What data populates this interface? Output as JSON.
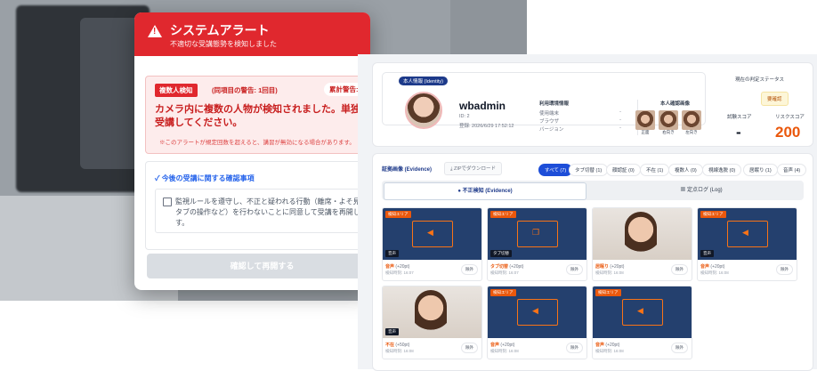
{
  "alert": {
    "title": "システムアラート",
    "subtitle": "不適切な受講態勢を検知しました",
    "detection_badge": "複数人検知",
    "detection_count": "(同項目の警告: 1回目)",
    "cumulative_label": "累計警告:",
    "message": "カメラ内に複数の人物が検知されました。単独で受講してください。",
    "note": "※このアラートが規定回数を超えると、講習が無効になる場合があります。",
    "confirm_title": "今後の受講に関する確認事項",
    "confirm_text": "監視ルールを遵守し、不正と疑われる行動（離席・よそ見・別タブの操作など）を行わないことに同意して受講を再開します。",
    "resume_button": "確認して再開する"
  },
  "admin": {
    "identity_badge": "本人情報 (Identity)",
    "username": "wbadmin",
    "user_id": "ID: 2",
    "registered": "登録: 2026/6/29 17:52:12",
    "env": {
      "title": "利用環境情報",
      "rows": [
        {
          "label": "使用端末",
          "value": "-"
        },
        {
          "label": "ブラウザ",
          "value": "-"
        },
        {
          "label": "バージョン",
          "value": "-"
        }
      ]
    },
    "photos": {
      "title": "本人確認画像",
      "labels": [
        "正面",
        "右向き",
        "左向き"
      ]
    },
    "status": {
      "title": "現在の判定ステータス",
      "value": "要確認"
    },
    "scores": {
      "exam_label": "試験スコア",
      "exam_value": "-",
      "risk_label": "リスクスコア",
      "risk_value": "200"
    },
    "evidence": {
      "title": "証拠画像 (Evidence)",
      "zip": "ZIPでダウンロード",
      "filters": [
        "すべて (7)",
        "タブ切替 (1)",
        "顔認証 (0)",
        "不在 (1)",
        "複数人 (0)",
        "視線逸脱 (0)",
        "居眠り (1)",
        "音声 (4)"
      ],
      "tabs": [
        "不正検知 (Evidence)",
        "定点ログ (Log)"
      ],
      "cards": [
        {
          "tag": "検知エリア",
          "kind": "音声",
          "name": "音声",
          "pts": "(+20pt)",
          "time": "検知時刻: 16:07",
          "exclude": "除外"
        },
        {
          "tag": "検知エリア",
          "kind": "タブ切替",
          "name": "タブ切替",
          "pts": "(+20pt)",
          "time": "検知時刻: 16:07",
          "exclude": "除外"
        },
        {
          "tag": "",
          "kind": "",
          "name": "居眠り",
          "pts": "(+20pt)",
          "time": "検知時刻: 16:08",
          "exclude": "除外"
        },
        {
          "tag": "検知エリア",
          "kind": "音声",
          "name": "音声",
          "pts": "(+20pt)",
          "time": "検知時刻: 16:08",
          "exclude": "除外"
        },
        {
          "tag": "",
          "kind": "音声",
          "name": "不在",
          "pts": "(+50pt)",
          "time": "検知時刻: 16:08",
          "exclude": "除外"
        },
        {
          "tag": "検知エリア",
          "kind": "",
          "name": "音声",
          "pts": "(+20pt)",
          "time": "検知時刻: 16:08",
          "exclude": "除外"
        },
        {
          "tag": "検知エリア",
          "kind": "",
          "name": "音声",
          "pts": "(+20pt)",
          "time": "検知時刻: 16:08",
          "exclude": "除外"
        }
      ]
    }
  },
  "colors": {
    "alert_red": "#e0282e",
    "accent_blue": "#1d4ed8",
    "risk_orange": "#ea580c"
  }
}
